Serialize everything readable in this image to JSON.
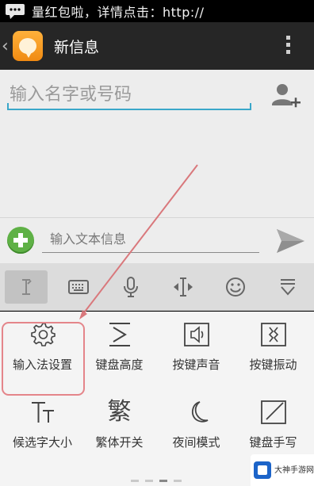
{
  "status_bar": {
    "notification_text": "量红包啦，详情点击：http://"
  },
  "action_bar": {
    "title": "新信息",
    "back_icon": "chevron-left-icon",
    "app_icon": "message-bubble-icon",
    "menu_icon": "overflow-menu-icon"
  },
  "compose": {
    "recipient_placeholder": "输入名字或号码",
    "message_placeholder": "输入文本信息"
  },
  "keyboard_toolbar": [
    {
      "name": "cursor-tool",
      "icon": "text-cursor-icon"
    },
    {
      "name": "keyboard-tool",
      "icon": "keyboard-icon"
    },
    {
      "name": "voice-tool",
      "icon": "microphone-icon"
    },
    {
      "name": "cursor-move-tool",
      "icon": "cursor-arrows-icon"
    },
    {
      "name": "emoji-tool",
      "icon": "smiley-icon"
    },
    {
      "name": "hide-keyboard-tool",
      "icon": "hide-keyboard-icon"
    }
  ],
  "settings": {
    "input_method_settings": "输入法设置",
    "keyboard_height": "键盘高度",
    "key_sound": "按键声音",
    "key_vibration": "按键振动",
    "candidate_font_size": "候选字大小",
    "traditional_switch": "繁体开关",
    "night_mode": "夜间模式",
    "partial_item": "键盘手写"
  },
  "colors": {
    "accent_underline": "#3aa7c9",
    "highlight_border": "#e4858a",
    "attach_green": "#5fb146",
    "app_icon_orange": "#f59a1f"
  },
  "watermark": {
    "text": "大神手游网"
  }
}
